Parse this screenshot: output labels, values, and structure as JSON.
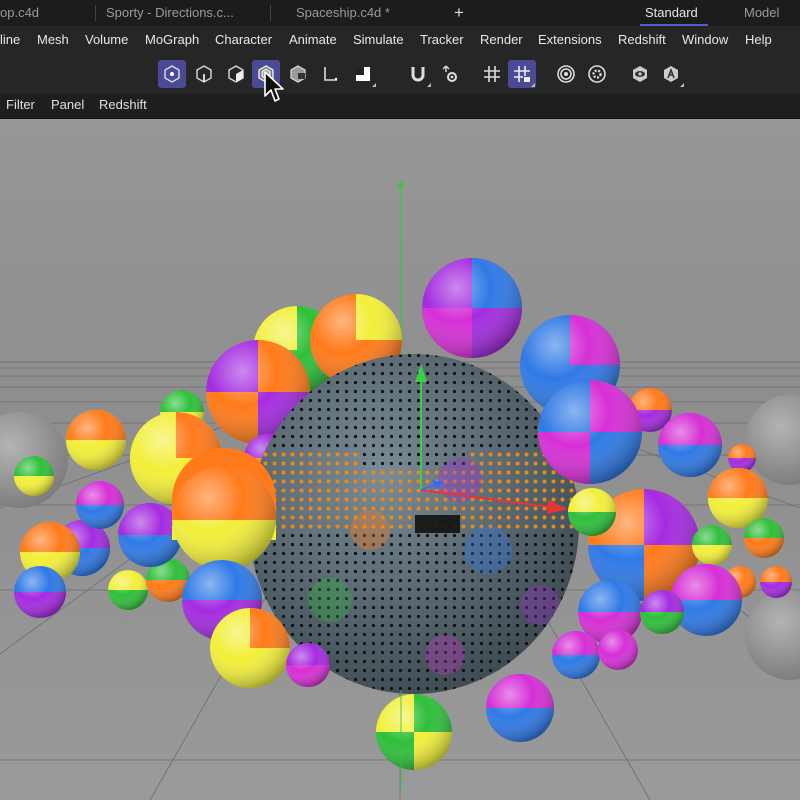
{
  "tabs": [
    {
      "label": "op.c4d"
    },
    {
      "label": "Sporty - Directions.c..."
    },
    {
      "label": "Spaceship.c4d *"
    }
  ],
  "new_tab_label": "+",
  "layouts": [
    {
      "label": "Standard",
      "active": true
    },
    {
      "label": "Model",
      "active": false
    }
  ],
  "menu": [
    {
      "label": "line"
    },
    {
      "label": "Mesh"
    },
    {
      "label": "Volume"
    },
    {
      "label": "MoGraph"
    },
    {
      "label": "Character"
    },
    {
      "label": "Animate"
    },
    {
      "label": "Simulate"
    },
    {
      "label": "Tracker"
    },
    {
      "label": "Render"
    },
    {
      "label": "Extensions"
    },
    {
      "label": "Redshift"
    },
    {
      "label": "Window"
    },
    {
      "label": "Help"
    }
  ],
  "toolbar": [
    {
      "icon": "points-mode-icon",
      "active": true
    },
    {
      "icon": "edges-mode-icon",
      "active": false
    },
    {
      "icon": "polygons-mode-icon",
      "active": false
    },
    {
      "icon": "uvw-mode-icon",
      "active": true
    },
    {
      "icon": "texture-mode-icon",
      "active": false
    },
    {
      "icon": "axis-mode-icon",
      "active": false
    },
    {
      "icon": "solo-mode-icon",
      "active": false
    },
    {
      "icon": "magnet-snap-icon",
      "active": false
    },
    {
      "icon": "snap-settings-icon",
      "active": false
    },
    {
      "icon": "grid-icon",
      "active": false
    },
    {
      "icon": "workplane-snap-icon",
      "active": true
    },
    {
      "icon": "render-region-icon",
      "active": false
    },
    {
      "icon": "render-settings-icon",
      "active": false
    },
    {
      "icon": "view-visibility-icon",
      "active": false
    },
    {
      "icon": "axis-lock-icon",
      "active": false
    }
  ],
  "viewport_menu": [
    {
      "label": "Filter"
    },
    {
      "label": "Panel"
    },
    {
      "label": "Redshift"
    }
  ],
  "colors": {
    "accent": "#5b5bd0",
    "tool_active": "#4a4a96",
    "ball_orange": "#ff7a1a",
    "ball_yellow": "#f2ef3a",
    "ball_purple": "#a42be0",
    "ball_blue": "#2f79e6",
    "ball_green": "#2fbf3a",
    "ball_magenta": "#d62fd6"
  }
}
